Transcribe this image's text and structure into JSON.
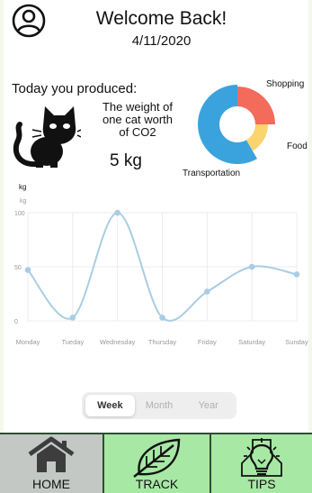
{
  "header": {
    "welcome": "Welcome Back!",
    "date": "4/11/2020"
  },
  "produced": {
    "title": "Today you produced:",
    "comparison_lines": [
      "The weight of",
      "one cat worth",
      "of CO2"
    ],
    "value": "5 kg"
  },
  "breakdown": {
    "labels": [
      "Shopping",
      "Food",
      "Transportation"
    ],
    "colors": [
      "#f26b5b",
      "#fbd46d",
      "#3aa3dd"
    ]
  },
  "chart_data": {
    "type": "line",
    "unit_label": "kg",
    "ylabel": "kg",
    "ylim": [
      0,
      100
    ],
    "yticks": [
      0,
      50,
      100
    ],
    "categories": [
      "Monday",
      "Tueday",
      "Wednesday",
      "Thursday",
      "Friday",
      "Saturday",
      "Sunday"
    ],
    "series": [
      {
        "values": [
          47,
          3,
          100,
          3,
          27,
          50,
          43
        ]
      }
    ],
    "smooth": true,
    "grid": true,
    "color": "#a9cde3"
  },
  "period_toggle": {
    "options": [
      "Week",
      "Month",
      "Year"
    ],
    "selected": "Week"
  },
  "nav": {
    "home": "HOME",
    "track": "TRACK",
    "tips": "TIPS"
  }
}
